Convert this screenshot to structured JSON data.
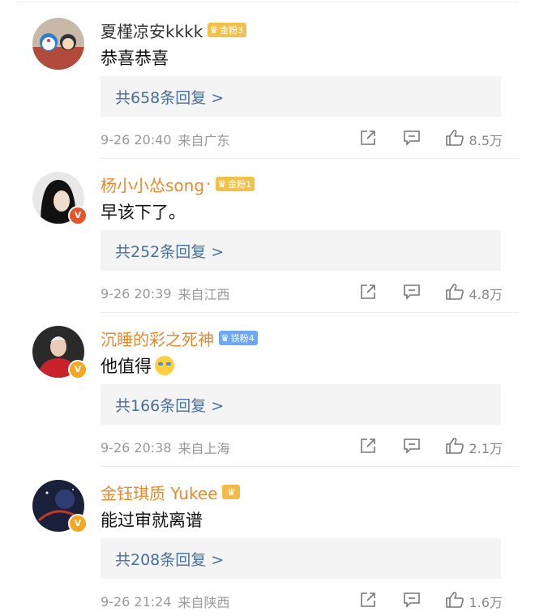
{
  "comments": [
    {
      "username": "夏槿凉安kkkk",
      "name_style": "gray",
      "dot": "",
      "fan_badge": "金粉3",
      "badge_type": "gold",
      "text": "恭喜恭喜",
      "replies": "共658条回复 >",
      "time": "9-26 20:40",
      "source": "来自广东",
      "likes": "8.5万",
      "avatar_style": "doraemon",
      "verify": ""
    },
    {
      "username": "杨小小怂song",
      "name_style": "orange",
      "dot": "·",
      "fan_badge": "金粉1",
      "badge_type": "gold",
      "text": "早该下了。",
      "replies": "共252条回复 >",
      "time": "9-26 20:39",
      "source": "来自江西",
      "likes": "4.8万",
      "avatar_style": "portrait",
      "verify": "red"
    },
    {
      "username": "沉睡的彩之死神",
      "name_style": "orange",
      "dot": "",
      "fan_badge": "铁粉4",
      "badge_type": "blue",
      "text": "他值得",
      "replies": "共166条回复 >",
      "time": "9-26 20:38",
      "source": "来自上海",
      "likes": "2.1万",
      "avatar_style": "red-jacket",
      "verify": "yellow"
    },
    {
      "username": "金钰琪质 Yukee",
      "name_style": "orange",
      "dot": "",
      "fan_badge": "",
      "badge_type": "crown",
      "text": "能过审就离谱",
      "replies": "共208条回复 >",
      "time": "9-26 21:24",
      "source": "来自陕西",
      "likes": "1.6万",
      "avatar_style": "space",
      "verify": "yellow"
    }
  ],
  "icons": {
    "share": "share-icon",
    "reply": "comment-icon",
    "like": "thumbs-up-icon",
    "verify": "verified-v-icon"
  },
  "colors": {
    "username": "#e58a2e",
    "reply_link": "#486e9c",
    "reply_bg": "#f4f4f4",
    "meta": "#999999"
  }
}
